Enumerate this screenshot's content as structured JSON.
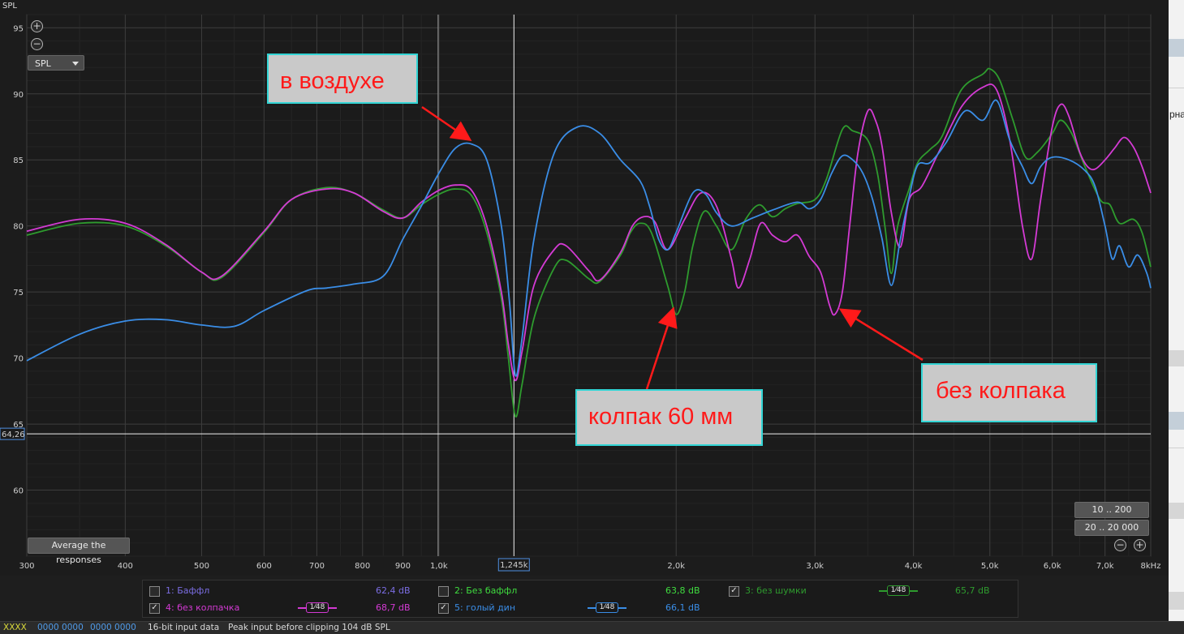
{
  "ui": {
    "y_axis_label": "SPL",
    "zoom_in": "+",
    "zoom_out": "−",
    "spl_select": "SPL",
    "average_button": "Average the responses",
    "range_buttons": [
      "10 .. 200",
      "20 .. 20 000"
    ],
    "cursor_y_readout": "64,26",
    "cursor_x_readout": "1,245k",
    "right_panel_text": "рна"
  },
  "annotations": {
    "air": "в воздухе",
    "cap": "колпак 60 мм",
    "nocap": "без колпака"
  },
  "legend": [
    {
      "index": "1: Баффл",
      "value": "62,4 dB",
      "checked": false,
      "color": "#7b6de3",
      "smoothing": ""
    },
    {
      "index": "2: Без баффл",
      "value": "63,8 dB",
      "checked": false,
      "color": "#3fdc3f",
      "smoothing": ""
    },
    {
      "index": "3: без шумки",
      "value": "65,7 dB",
      "checked": true,
      "color": "#2e9b2e",
      "smoothing": "1⁄48"
    },
    {
      "index": "4: без колпачка",
      "value": "68,7 dB",
      "checked": true,
      "color": "#d43ad4",
      "smoothing": "1⁄48"
    },
    {
      "index": "5: голый дин",
      "value": "66,1 dB",
      "checked": true,
      "color": "#3a8de6",
      "smoothing": "1⁄48"
    }
  ],
  "status_bar": {
    "code1": "XXXX",
    "code2": "0000 0000",
    "code3": "0000 0000",
    "bitdepth": "16-bit input data",
    "peak": "Peak input before clipping 104 dB SPL"
  },
  "chart_data": {
    "type": "line",
    "xlabel": "",
    "ylabel": "SPL",
    "x_scale": "log",
    "xlim": [
      300,
      8000
    ],
    "ylim": [
      55,
      96
    ],
    "yticks": [
      60,
      65,
      70,
      75,
      80,
      85,
      90,
      95
    ],
    "xticks": [
      {
        "v": 300,
        "label": "300"
      },
      {
        "v": 400,
        "label": "400"
      },
      {
        "v": 500,
        "label": "500"
      },
      {
        "v": 600,
        "label": "600"
      },
      {
        "v": 700,
        "label": "700"
      },
      {
        "v": 800,
        "label": "800"
      },
      {
        "v": 900,
        "label": "900"
      },
      {
        "v": 1000,
        "label": "1,0k"
      },
      {
        "v": 2000,
        "label": "2,0k"
      },
      {
        "v": 3000,
        "label": "3,0k"
      },
      {
        "v": 4000,
        "label": "4,0k"
      },
      {
        "v": 5000,
        "label": "5,0k"
      },
      {
        "v": 6000,
        "label": "6,0k"
      },
      {
        "v": 7000,
        "label": "7,0k"
      },
      {
        "v": 8000,
        "label": "8kHz"
      }
    ],
    "grid": true,
    "cursor": {
      "x": 1245,
      "y": 64.26
    },
    "series": [
      {
        "name": "3: без шумки",
        "color": "#2e9b2e",
        "points": [
          [
            300,
            79.3
          ],
          [
            350,
            80.2
          ],
          [
            400,
            80.0
          ],
          [
            450,
            78.5
          ],
          [
            500,
            76.5
          ],
          [
            530,
            76.1
          ],
          [
            600,
            79.5
          ],
          [
            650,
            82.0
          ],
          [
            720,
            82.9
          ],
          [
            780,
            82.5
          ],
          [
            850,
            81.2
          ],
          [
            900,
            80.6
          ],
          [
            950,
            81.6
          ],
          [
            1000,
            82.4
          ],
          [
            1050,
            82.8
          ],
          [
            1100,
            82.3
          ],
          [
            1150,
            79.5
          ],
          [
            1200,
            74.5
          ],
          [
            1225,
            70.0
          ],
          [
            1250,
            65.6
          ],
          [
            1275,
            68.0
          ],
          [
            1320,
            73.0
          ],
          [
            1400,
            76.8
          ],
          [
            1450,
            77.4
          ],
          [
            1550,
            76.0
          ],
          [
            1600,
            75.8
          ],
          [
            1700,
            77.8
          ],
          [
            1750,
            79.5
          ],
          [
            1800,
            80.2
          ],
          [
            1860,
            79.5
          ],
          [
            1950,
            75.5
          ],
          [
            2000,
            73.3
          ],
          [
            2050,
            75.0
          ],
          [
            2100,
            78.5
          ],
          [
            2170,
            81.1
          ],
          [
            2250,
            80.0
          ],
          [
            2350,
            78.2
          ],
          [
            2450,
            80.5
          ],
          [
            2550,
            81.6
          ],
          [
            2650,
            80.7
          ],
          [
            2750,
            81.3
          ],
          [
            2850,
            81.7
          ],
          [
            3000,
            82.0
          ],
          [
            3100,
            83.5
          ],
          [
            3250,
            87.3
          ],
          [
            3350,
            87.2
          ],
          [
            3500,
            86.5
          ],
          [
            3600,
            84.0
          ],
          [
            3680,
            80.0
          ],
          [
            3750,
            76.4
          ],
          [
            3820,
            80.0
          ],
          [
            3950,
            82.8
          ],
          [
            4050,
            84.8
          ],
          [
            4200,
            85.8
          ],
          [
            4350,
            86.8
          ],
          [
            4600,
            90.3
          ],
          [
            4900,
            91.5
          ],
          [
            5000,
            91.9
          ],
          [
            5150,
            91.0
          ],
          [
            5350,
            88.0
          ],
          [
            5550,
            85.2
          ],
          [
            5750,
            85.6
          ],
          [
            6000,
            87.0
          ],
          [
            6150,
            88.0
          ],
          [
            6350,
            87.0
          ],
          [
            6600,
            84.5
          ],
          [
            6900,
            82.0
          ],
          [
            7100,
            81.6
          ],
          [
            7300,
            80.2
          ],
          [
            7600,
            80.5
          ],
          [
            7800,
            79.5
          ],
          [
            8000,
            76.9
          ]
        ]
      },
      {
        "name": "4: без колпачка",
        "color": "#d43ad4",
        "points": [
          [
            300,
            79.6
          ],
          [
            350,
            80.5
          ],
          [
            400,
            80.2
          ],
          [
            450,
            78.6
          ],
          [
            500,
            76.5
          ],
          [
            530,
            76.2
          ],
          [
            600,
            79.6
          ],
          [
            650,
            82.0
          ],
          [
            720,
            82.8
          ],
          [
            780,
            82.5
          ],
          [
            850,
            81.1
          ],
          [
            900,
            80.6
          ],
          [
            950,
            81.8
          ],
          [
            1000,
            82.7
          ],
          [
            1050,
            83.1
          ],
          [
            1100,
            82.7
          ],
          [
            1150,
            80.0
          ],
          [
            1200,
            75.0
          ],
          [
            1225,
            71.0
          ],
          [
            1250,
            68.3
          ],
          [
            1275,
            70.5
          ],
          [
            1320,
            75.5
          ],
          [
            1400,
            78.2
          ],
          [
            1450,
            78.5
          ],
          [
            1550,
            76.6
          ],
          [
            1600,
            75.9
          ],
          [
            1700,
            78.0
          ],
          [
            1760,
            80.0
          ],
          [
            1820,
            80.7
          ],
          [
            1880,
            80.3
          ],
          [
            1950,
            78.2
          ],
          [
            2050,
            80.5
          ],
          [
            2150,
            82.5
          ],
          [
            2250,
            81.5
          ],
          [
            2350,
            77.5
          ],
          [
            2400,
            75.3
          ],
          [
            2480,
            77.5
          ],
          [
            2560,
            80.2
          ],
          [
            2650,
            79.3
          ],
          [
            2750,
            78.8
          ],
          [
            2850,
            79.3
          ],
          [
            2950,
            77.7
          ],
          [
            3050,
            76.5
          ],
          [
            3130,
            74.0
          ],
          [
            3180,
            73.3
          ],
          [
            3250,
            75.0
          ],
          [
            3320,
            80.0
          ],
          [
            3400,
            85.5
          ],
          [
            3500,
            88.7
          ],
          [
            3580,
            88.0
          ],
          [
            3650,
            86.0
          ],
          [
            3750,
            81.0
          ],
          [
            3850,
            78.4
          ],
          [
            3950,
            82.0
          ],
          [
            4100,
            83.0
          ],
          [
            4300,
            85.5
          ],
          [
            4600,
            89.0
          ],
          [
            4900,
            90.5
          ],
          [
            5100,
            90.3
          ],
          [
            5300,
            86.5
          ],
          [
            5500,
            80.0
          ],
          [
            5650,
            77.5
          ],
          [
            5800,
            82.0
          ],
          [
            6000,
            87.5
          ],
          [
            6150,
            89.2
          ],
          [
            6300,
            88.3
          ],
          [
            6500,
            85.6
          ],
          [
            6650,
            84.5
          ],
          [
            6800,
            84.3
          ],
          [
            7000,
            85.0
          ],
          [
            7200,
            85.9
          ],
          [
            7400,
            86.7
          ],
          [
            7600,
            86.0
          ],
          [
            7800,
            84.5
          ],
          [
            8000,
            82.5
          ]
        ]
      },
      {
        "name": "5: голый дин",
        "color": "#3a8de6",
        "points": [
          [
            300,
            69.8
          ],
          [
            350,
            71.8
          ],
          [
            400,
            72.8
          ],
          [
            450,
            72.9
          ],
          [
            500,
            72.5
          ],
          [
            550,
            72.4
          ],
          [
            600,
            73.6
          ],
          [
            680,
            75.1
          ],
          [
            720,
            75.3
          ],
          [
            780,
            75.6
          ],
          [
            850,
            76.2
          ],
          [
            900,
            79.0
          ],
          [
            950,
            81.5
          ],
          [
            1000,
            84.0
          ],
          [
            1050,
            85.9
          ],
          [
            1100,
            86.2
          ],
          [
            1150,
            85.0
          ],
          [
            1200,
            80.0
          ],
          [
            1230,
            74.0
          ],
          [
            1250,
            68.7
          ],
          [
            1275,
            71.5
          ],
          [
            1320,
            79.0
          ],
          [
            1400,
            85.5
          ],
          [
            1500,
            87.5
          ],
          [
            1600,
            87.0
          ],
          [
            1700,
            85.0
          ],
          [
            1800,
            83.4
          ],
          [
            1850,
            81.5
          ],
          [
            1900,
            79.0
          ],
          [
            1950,
            78.2
          ],
          [
            2000,
            79.5
          ],
          [
            2100,
            82.5
          ],
          [
            2180,
            82.4
          ],
          [
            2250,
            81.0
          ],
          [
            2350,
            80.0
          ],
          [
            2500,
            80.6
          ],
          [
            2650,
            81.2
          ],
          [
            2850,
            81.8
          ],
          [
            2950,
            81.3
          ],
          [
            3050,
            82.0
          ],
          [
            3150,
            84.0
          ],
          [
            3250,
            85.3
          ],
          [
            3350,
            85.0
          ],
          [
            3450,
            84.0
          ],
          [
            3550,
            82.0
          ],
          [
            3650,
            79.0
          ],
          [
            3750,
            75.5
          ],
          [
            3850,
            79.0
          ],
          [
            3950,
            82.2
          ],
          [
            4050,
            84.6
          ],
          [
            4200,
            84.8
          ],
          [
            4400,
            86.3
          ],
          [
            4650,
            88.7
          ],
          [
            4900,
            88.0
          ],
          [
            5100,
            89.5
          ],
          [
            5300,
            86.5
          ],
          [
            5500,
            84.5
          ],
          [
            5650,
            83.2
          ],
          [
            5800,
            84.5
          ],
          [
            6000,
            85.2
          ],
          [
            6300,
            85.0
          ],
          [
            6600,
            84.2
          ],
          [
            6800,
            83.0
          ],
          [
            7000,
            80.0
          ],
          [
            7150,
            77.5
          ],
          [
            7300,
            78.5
          ],
          [
            7500,
            76.9
          ],
          [
            7700,
            77.8
          ],
          [
            7900,
            76.5
          ],
          [
            8000,
            75.3
          ]
        ]
      }
    ]
  }
}
